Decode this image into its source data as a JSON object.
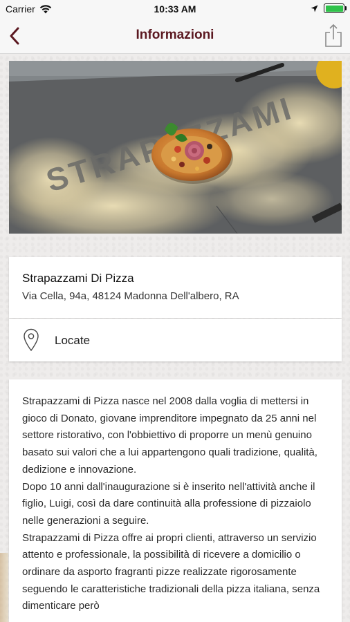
{
  "status_bar": {
    "carrier": "Carrier",
    "time": "10:33 AM"
  },
  "nav": {
    "title": "Informazioni"
  },
  "hero": {
    "floor_writing": "STRAPAZZAMI"
  },
  "info_card": {
    "name": "Strapazzami Di Pizza",
    "address": "Via Cella, 94a, 48124 Madonna Dell'albero, RA"
  },
  "locate": {
    "label": "Locate"
  },
  "description": {
    "paragraphs": [
      "Strapazzami di Pizza nasce nel 2008 dalla voglia di mettersi in gioco di Donato, giovane imprenditore impegnato da 25 anni nel settore ristorativo, con l'obbiettivo di proporre un menù genuino basato sui valori che a lui appartengono quali tradizione, qualità, dedizione e innovazione.",
      "Dopo 10 anni dall'inaugurazione si è inserito nell'attività anche il figlio, Luigi, così da dare continuità alla professione di pizzaiolo nelle generazioni a seguire.",
      "Strapazzami di Pizza offre ai propri clienti, attraverso un servizio attento e professionale, la possibilità di ricevere a domicilio o ordinare da asporto fragranti pizze realizzate rigorosamente seguendo le caratteristiche tradizionali della pizza italiana, senza dimenticare però"
    ]
  },
  "colors": {
    "nav_title": "#5b1820",
    "accent": "#5b1820",
    "battery": "#2fc24a"
  }
}
